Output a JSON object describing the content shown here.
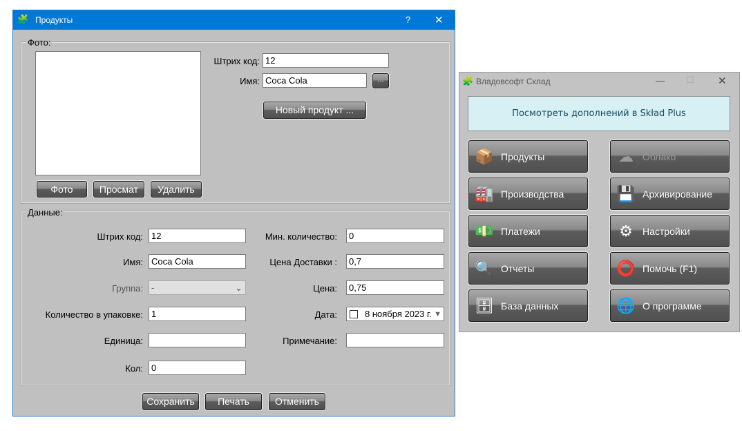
{
  "products_window": {
    "title": "Продукты",
    "help": "?",
    "close": "✕",
    "photo_group": {
      "label": "Фото:",
      "buttons": [
        "Фото",
        "Просмат",
        "Удалить"
      ]
    },
    "barcode": {
      "label": "Штрих код:",
      "value": "12"
    },
    "name": {
      "label": "Имя:",
      "value": "Coca Cola",
      "browse": "..."
    },
    "new_product": "Новый продукт ...",
    "data_group": {
      "label": "Данные:",
      "left": [
        {
          "label": "Штрих код:",
          "value": "12"
        },
        {
          "label": "Имя:",
          "value": "Coca Cola"
        },
        {
          "label": "Группа:",
          "value": "-"
        },
        {
          "label": "Количество в упаковке:",
          "value": "1"
        },
        {
          "label": "Единица:",
          "value": ""
        },
        {
          "label": "Кол:",
          "value": "0"
        }
      ],
      "right": [
        {
          "label": "Мин. количество:",
          "value": "0"
        },
        {
          "label": "Цена Доставки :",
          "value": "0,7"
        },
        {
          "label": "Цена:",
          "value": "0,75"
        },
        {
          "label": "Дата:",
          "value": "8 ноября 2023 г."
        },
        {
          "label": "Примечание:",
          "value": ""
        }
      ]
    },
    "footer": [
      "Сохранить",
      "Печать",
      "Отменить"
    ]
  },
  "main_window": {
    "title": "Владовсофт Склад",
    "minimize": "—",
    "maximize": "☐",
    "close": "✕",
    "banner": "Посмотреть дополнений в Skład Plus",
    "buttons": [
      {
        "label": "Продукты",
        "icon": "boxes-icon"
      },
      {
        "label": "Облако",
        "icon": "cloud-icon",
        "disabled": true
      },
      {
        "label": "Производства",
        "icon": "factory-icon"
      },
      {
        "label": "Архивирование",
        "icon": "archive-icon"
      },
      {
        "label": "Платежи",
        "icon": "money-icon"
      },
      {
        "label": "Настройки",
        "icon": "settings-icon"
      },
      {
        "label": "Отчеты",
        "icon": "report-icon"
      },
      {
        "label": "Помочь (F1)",
        "icon": "lifebuoy-icon"
      },
      {
        "label": "База данных",
        "icon": "database-icon"
      },
      {
        "label": "О программе",
        "icon": "globe-monitor-icon"
      }
    ]
  }
}
